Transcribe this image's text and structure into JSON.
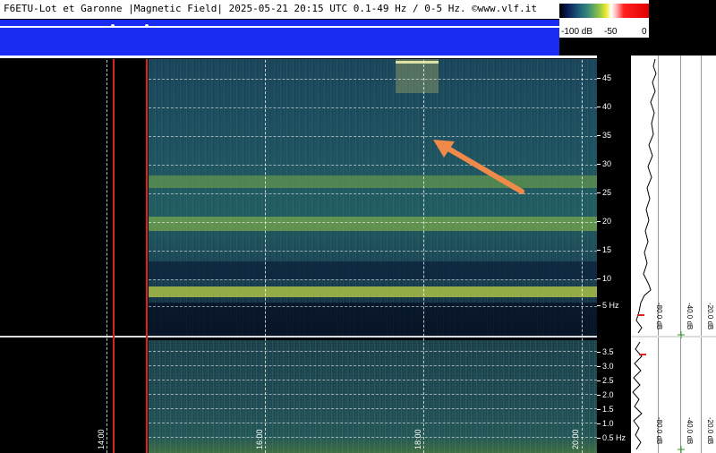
{
  "header": {
    "title": "F6ETU-Lot et Garonne |Magnetic Field| 2025-05-21 20:15 UTC 0.1-49 Hz / 0-5 Hz. ©www.vlf.it",
    "colorbar": {
      "labels": [
        "-100 dB",
        "-50",
        "0"
      ]
    }
  },
  "time_axis": {
    "labels": [
      "14:00",
      "16:00",
      "18:00",
      "20:00"
    ]
  },
  "freq_axis_top": {
    "labels": [
      "45",
      "40",
      "35",
      "30",
      "25",
      "20",
      "15",
      "10",
      "5 Hz"
    ]
  },
  "freq_axis_bottom": {
    "labels": [
      "3.5",
      "3.0",
      "2.5",
      "2.0",
      "1.5",
      "1.0",
      "0.5 Hz"
    ]
  },
  "power_scale_top": {
    "labels": [
      "-80.0 dB",
      "-40.0 dB",
      "-20.0 dB"
    ]
  },
  "power_scale_bottom": {
    "labels": [
      "-80.0 dB",
      "-40.0 dB",
      "-20.0 dB"
    ]
  },
  "colors": {
    "header": "#1a2cf2",
    "marker": "#d8241c",
    "arrow": "#f08a4b"
  }
}
